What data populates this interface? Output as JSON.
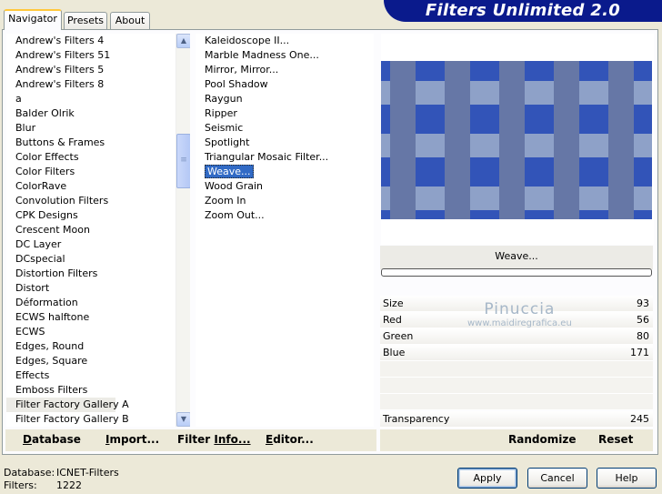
{
  "tabs": [
    "Navigator",
    "Presets",
    "About"
  ],
  "banner_title": "Filters Unlimited 2.0",
  "categories": [
    "Andrew's Filters 4",
    "Andrew's Filters 51",
    "Andrew's Filters 5",
    "Andrew's Filters 8",
    "a",
    "Balder Olrik",
    "Blur",
    "Buttons & Frames",
    "Color Effects",
    "Color Filters",
    "ColorRave",
    "Convolution Filters",
    "CPK Designs",
    "Crescent Moon",
    "DC Layer",
    "DCspecial",
    "Distortion Filters",
    "Distort",
    "Déformation",
    "ECWS halftone",
    "ECWS",
    "Edges, Round",
    "Edges, Square",
    "Effects",
    "Emboss Filters",
    "Filter Factory Gallery A",
    "Filter Factory Gallery B"
  ],
  "highlighted_category": "Filter Factory Gallery A",
  "filters": [
    "Kaleidoscope II...",
    "Marble Madness One...",
    "Mirror, Mirror...",
    "Pool Shadow",
    "Raygun",
    "Ripper",
    "Seismic",
    "Spotlight",
    "Triangular Mosaic Filter...",
    "Weave...",
    "Wood Grain",
    "Zoom In",
    "Zoom Out..."
  ],
  "selected_filter": "Weave...",
  "preview_label": "Weave...",
  "params": [
    {
      "name": "Size",
      "value": "93"
    },
    {
      "name": "Red",
      "value": "56"
    },
    {
      "name": "Green",
      "value": "80"
    },
    {
      "name": "Blue",
      "value": "171"
    }
  ],
  "transparency": {
    "name": "Transparency",
    "value": "245"
  },
  "watermark": {
    "line1": "Pinuccia",
    "line2": "www.maidiregrafica.eu"
  },
  "actions_left": [
    {
      "label": "Database",
      "underline": "D",
      "rest": "atabase"
    },
    {
      "label": "Import...",
      "underline": "I",
      "rest": "mport..."
    },
    {
      "label": "Filter Info...",
      "underline": "Filter ",
      "rest": "Info..."
    },
    {
      "label": "Editor...",
      "underline": "E",
      "rest": "ditor..."
    }
  ],
  "actions_right": [
    "Randomize",
    "Reset"
  ],
  "status": {
    "database_label": "Database:",
    "database_value": "ICNET-Filters",
    "filters_label": "Filters:",
    "filters_value": "1222"
  },
  "buttons": {
    "apply": "Apply",
    "cancel": "Cancel",
    "help": "Help"
  },
  "colors": {
    "banner": "#0a1a8c",
    "selection": "#316ac5",
    "weave_base": "#3254b8"
  }
}
